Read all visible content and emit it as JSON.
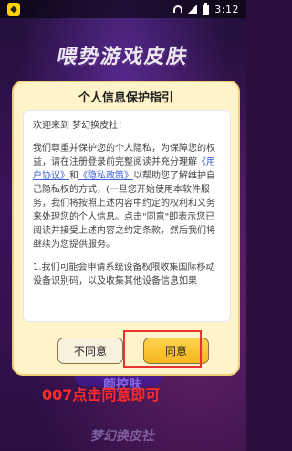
{
  "status_bar": {
    "time": "3:12"
  },
  "background": {
    "title_text": "喂势游戏皮肤",
    "badge_text": "颜控肤",
    "bottom_text": "梦幻换皮社"
  },
  "dialog": {
    "title": "个人信息保护指引",
    "greeting": "欢迎来到 梦幻换皮社！",
    "p2_part1": "我们尊重并保护您的个人隐私，为保障您的权益，请在注册登录前完整阅读并充分理解",
    "link_user_agreement": "《用户协议》",
    "and_word": "和",
    "link_privacy_policy": "《隐私政策》",
    "p2_part2": "以帮助您了解维护自己隐私权的方式，(一旦您开始使用本软件服务，我们将按照上述内容中约定的权利和义务来处理您的个人信息。点击\"同意\"即表示您已阅读并接受上述内容之约定条款，然后我们将继续为您提供服务。",
    "p3": "1.我们可能会申请系统设备权限收集国际移动设备识别码，以及收集其他设备信息如果",
    "disagree_label": "不同意",
    "agree_label": "同意"
  },
  "annotation": {
    "caption": "007点击同意即可",
    "color": "#e3342f"
  }
}
